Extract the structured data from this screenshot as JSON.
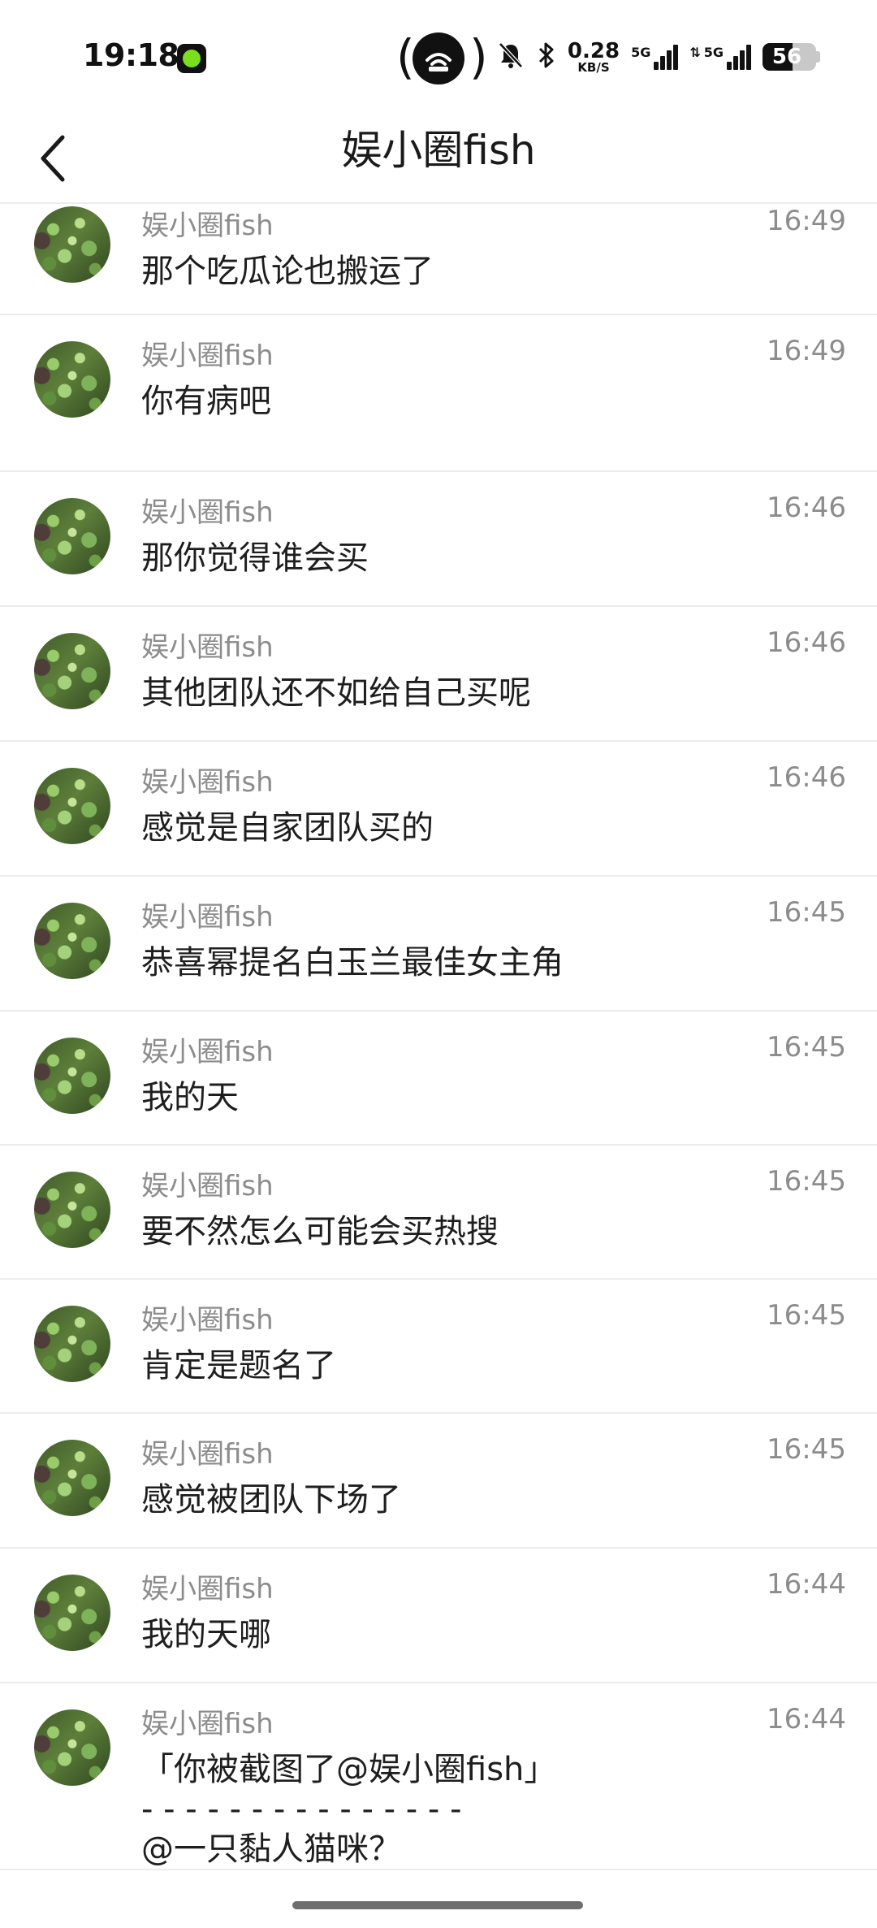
{
  "status_bar": {
    "time": "19:18",
    "net_speed": "0.28",
    "net_speed_unit": "KB/S",
    "sim1_label": "5G",
    "sim2_label": "5G",
    "battery": "56",
    "battery_level": 0.56
  },
  "header": {
    "title": "娱小圈fish",
    "back_icon": "chevron-left-icon"
  },
  "messages": [
    {
      "sender": "娱小圈fish",
      "time": "16:49",
      "lines": [
        "那个吃瓜论也搬运了"
      ]
    },
    {
      "sender": "娱小圈fish",
      "time": "16:49",
      "lines": [
        "你有病吧"
      ]
    },
    {
      "sender": "娱小圈fish",
      "time": "16:46",
      "lines": [
        "那你觉得谁会买"
      ]
    },
    {
      "sender": "娱小圈fish",
      "time": "16:46",
      "lines": [
        "其他团队还不如给自己买呢"
      ]
    },
    {
      "sender": "娱小圈fish",
      "time": "16:46",
      "lines": [
        "感觉是自家团队买的"
      ]
    },
    {
      "sender": "娱小圈fish",
      "time": "16:45",
      "lines": [
        "恭喜幂提名白玉兰最佳女主角"
      ]
    },
    {
      "sender": "娱小圈fish",
      "time": "16:45",
      "lines": [
        "我的天"
      ]
    },
    {
      "sender": "娱小圈fish",
      "time": "16:45",
      "lines": [
        "要不然怎么可能会买热搜"
      ]
    },
    {
      "sender": "娱小圈fish",
      "time": "16:45",
      "lines": [
        "肯定是题名了"
      ]
    },
    {
      "sender": "娱小圈fish",
      "time": "16:45",
      "lines": [
        "感觉被团队下场了"
      ]
    },
    {
      "sender": "娱小圈fish",
      "time": "16:44",
      "lines": [
        "我的天哪"
      ]
    },
    {
      "sender": "娱小圈fish",
      "time": "16:44",
      "lines": [
        "「你被截图了@娱小圈fish」",
        "- - - - - - - - - - - - - - -",
        "@一只黏人猫咪？"
      ]
    }
  ]
}
